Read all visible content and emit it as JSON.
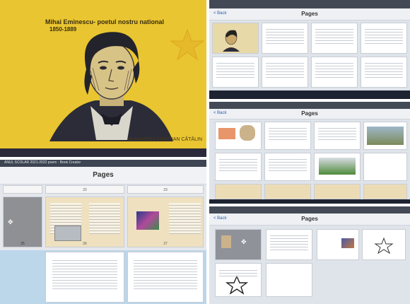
{
  "slide": {
    "title": "Mihai Eminescu- poetul nostru national",
    "years": "1850-1889",
    "author": "de MACREA CRISTIAN CĂTĂLIN",
    "colors": {
      "background": "#e9c531",
      "ink": "#3a2e10"
    }
  },
  "photo2": {
    "back": "< Back",
    "title": "Pages"
  },
  "photo3": {
    "topbar": "ANUL SCOLAR 2021-2022 poem · Book Creator",
    "title": "Pages",
    "top_numbers": [
      "22",
      "23"
    ],
    "bottom_numbers": [
      "25",
      "26",
      "27"
    ]
  },
  "photo4": {
    "back": "< Back",
    "title": "Pages"
  },
  "photo5": {
    "back": "< Back",
    "title": "Pages"
  }
}
